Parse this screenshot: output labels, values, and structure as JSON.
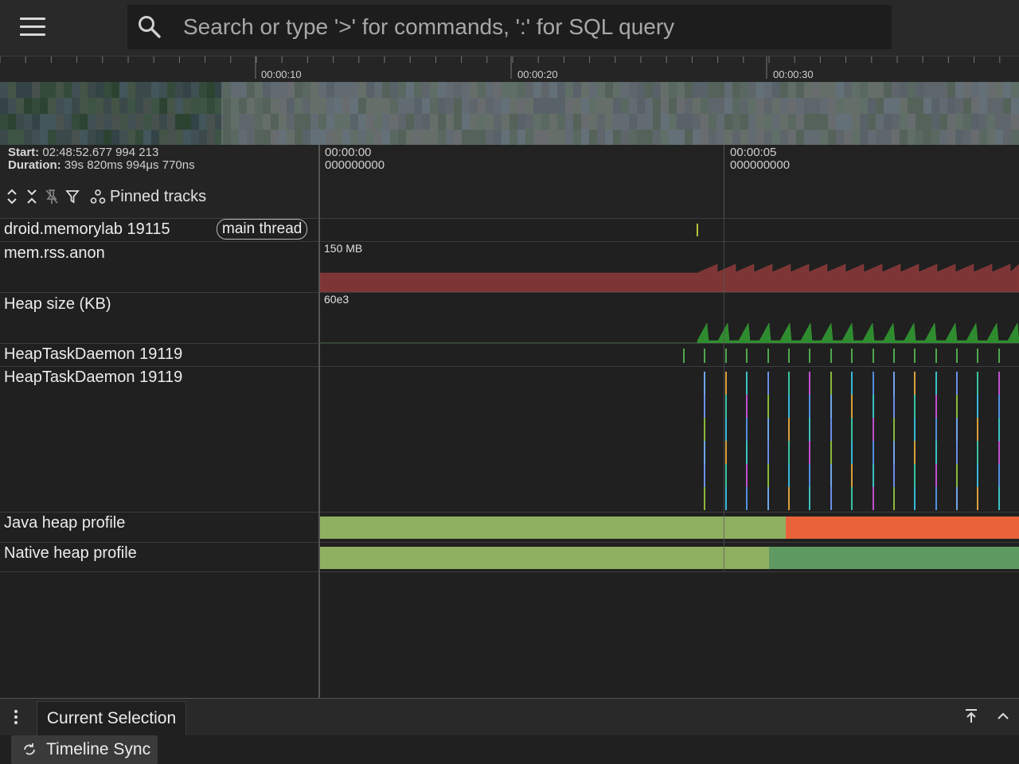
{
  "search": {
    "placeholder": "Search or type '>' for commands, ':' for SQL query"
  },
  "overview": {
    "ticks": [
      "00:00:10",
      "00:00:20",
      "00:00:30"
    ]
  },
  "info": {
    "start_label": "Start:",
    "start_value": "02:48:52.677 994 213",
    "duration_label": "Duration:",
    "duration_value": "39s 820ms 994μs 770ns"
  },
  "toolbar": {
    "pinned_label": "Pinned tracks"
  },
  "ruler": {
    "marks": [
      {
        "time": "00:00:00",
        "sub": "000000000"
      },
      {
        "time": "00:00:05",
        "sub": "000000000"
      }
    ]
  },
  "tracks": {
    "main_thread": {
      "title": "droid.memorylab 19115",
      "chip": "main thread"
    },
    "rss": {
      "title": "mem.rss.anon",
      "scale": "150 MB"
    },
    "heap_size": {
      "title": "Heap size (KB)",
      "scale": "60e3"
    },
    "heap_daemon_1": {
      "title": "HeapTaskDaemon 19119"
    },
    "heap_daemon_2": {
      "title": "HeapTaskDaemon 19119"
    },
    "java_heap": {
      "title": "Java heap profile"
    },
    "native_heap": {
      "title": "Native heap profile"
    }
  },
  "bottom": {
    "tab_current": "Current Selection",
    "sync_label": "Timeline Sync"
  },
  "colors": {
    "rss": "#7d3535",
    "heap": "#2e8b2e",
    "java_light": "#8fb060",
    "java_orange": "#e8633a",
    "native_dark": "#5f9a63"
  }
}
